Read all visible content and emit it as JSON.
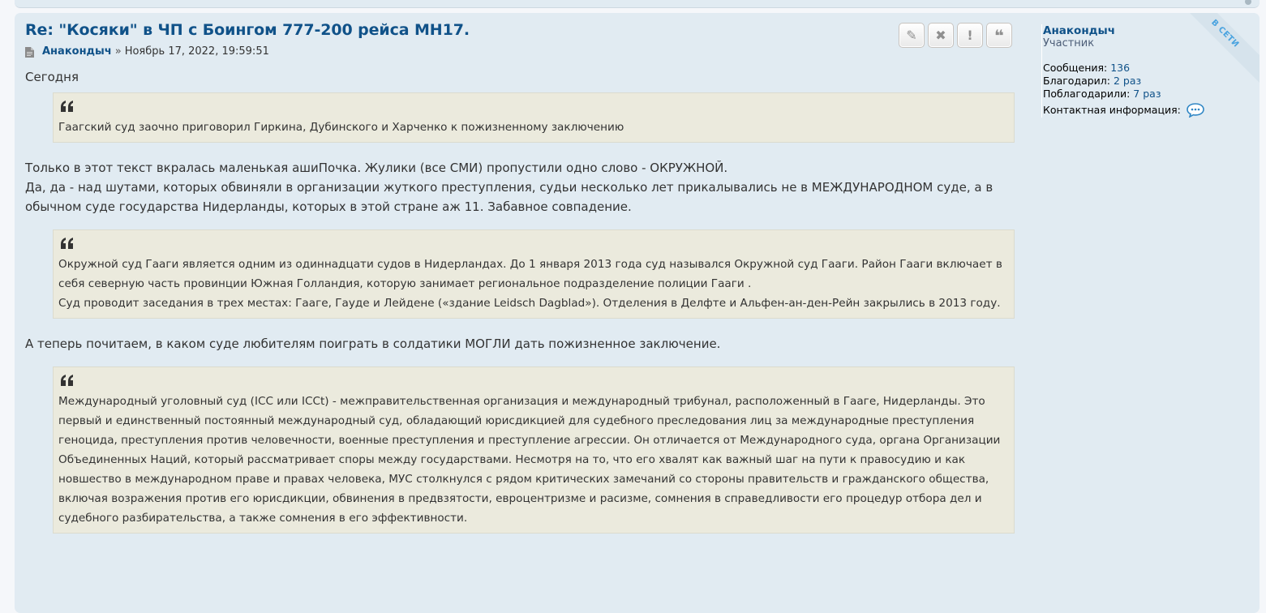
{
  "post": {
    "title": "Re: \"Косяки\" в ЧП с Боингом 777-200 рейса MH17.",
    "author": "Анакондыч",
    "separator": "»",
    "date": "Ноябрь 17, 2022, 19:59:51",
    "buttons": [
      {
        "name": "edit",
        "icon": "pencil-icon",
        "glyph": "✎"
      },
      {
        "name": "delete",
        "icon": "close-icon",
        "glyph": "✖"
      },
      {
        "name": "report",
        "icon": "exclamation-icon",
        "glyph": "!"
      },
      {
        "name": "quote",
        "icon": "quote-icon",
        "glyph": "❝"
      }
    ],
    "content": {
      "p1": "Сегодня",
      "quote1": "Гаагский суд заочно приговорил Гиркина, Дубинского и Харченко к пожизненному заключению",
      "p2_line1": "Только в этот текст вкралась маленькая ашиПочка. Жулики (все СМИ) пропустили одно слово - ОКРУЖНОЙ.",
      "p2_line2": "Да, да - над шутами, которых обвиняли в организации жуткого преступления, судьи несколько лет прикалывались не в МЕЖДУНАРОДНОМ суде, а в обычном суде государства Нидерланды, которых в этой стране аж 11. Забавное совпадение.",
      "quote2_line1": "Окружной суд Гааги является одним из одиннадцати судов в Нидерландах. До 1 января 2013 года суд назывался Окружной суд Гааги. Район Гааги включает в себя северную часть провинции Южная Голландия, которую занимает региональное подразделение полиции Гааги .",
      "quote2_line2": "Суд проводит заседания в трех местах: Гааге, Гауде и Лейдене («здание Leidsch Dagblad»). Отделения в Делфте и Альфен-ан-ден-Рейн закрылись в 2013 году.",
      "p3": "А теперь почитаем, в каком суде любителям поиграть в солдатики МОГЛИ дать пожизненное заключение.",
      "quote3": "Международный уголовный суд (ICC или ICCt) - межправительственная организация и международный трибунал, расположенный в Гааге, Нидерланды. Это первый и единственный постоянный международный суд, обладающий юрисдикцией для судебного преследования лиц за международные преступления геноцида, преступления против человечности, военные преступления и преступление агрессии. Он отличается от Международного суда, органа Организации Объединенных Наций, который рассматривает споры между государствами. Несмотря на то, что его хвалят как важный шаг на пути к правосудию и как новшество в международном праве и правах человека, МУС столкнулся с рядом критических замечаний со стороны правительств и гражданского общества, включая возражения против его юрисдикции, обвинения в предвзятости, евроцентризме и расизме, сомнения в справедливости его процедур отбора дел и судебного разбирательства, а также сомнения в его эффективности."
    }
  },
  "profile": {
    "name": "Анакондыч",
    "rank": "Участник",
    "posts_label": "Сообщения:",
    "posts_value": "136",
    "thanked_label": "Благодарил:",
    "thanked_value": "2 раз",
    "was_thanked_label": "Поблагодарили:",
    "was_thanked_value": "7 раз",
    "contact_label": "Контактная информация:",
    "contact_icon": "speech-bubble-icon",
    "online_badge": "В СЕТИ"
  },
  "colors": {
    "title": "#105289",
    "post_bg": "#e1ebf2",
    "quote_bg": "#ebeadd",
    "text": "#333333",
    "online": "#4aa3df"
  }
}
